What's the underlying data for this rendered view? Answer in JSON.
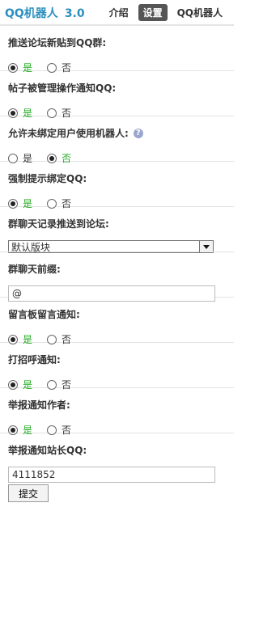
{
  "header": {
    "title": "QQ机器人",
    "version": "3.0",
    "tabs": [
      {
        "label": "介绍",
        "active": false
      },
      {
        "label": "设置",
        "active": true
      },
      {
        "label": "QQ机器人",
        "active": false
      }
    ]
  },
  "settings": {
    "push_forum_posts": {
      "label": "推送论坛新贴到QQ群:",
      "yes": "是",
      "no": "否",
      "value": "yes"
    },
    "post_admin_notify": {
      "label": "帖子被管理操作通知QQ:",
      "yes": "是",
      "no": "否",
      "value": "yes"
    },
    "allow_unbound_users": {
      "label": "允许未绑定用户使用机器人:",
      "yes": "是",
      "no": "否",
      "value": "no",
      "help_icon": "question-icon"
    },
    "force_bind_prompt": {
      "label": "强制提示绑定QQ:",
      "yes": "是",
      "no": "否",
      "value": "yes"
    },
    "group_chat_to_forum": {
      "label": "群聊天记录推送到论坛:",
      "selected": "默认版块"
    },
    "group_chat_prefix": {
      "label": "群聊天前缀:",
      "value": "@"
    },
    "guestbook_notify": {
      "label": "留言板留言通知:",
      "yes": "是",
      "no": "否",
      "value": "yes"
    },
    "greet_notify": {
      "label": "打招呼通知:",
      "yes": "是",
      "no": "否",
      "value": "yes"
    },
    "report_notify_author": {
      "label": "举报通知作者:",
      "yes": "是",
      "no": "否",
      "value": "yes"
    },
    "report_notify_admin_qq": {
      "label": "举报通知站长QQ:",
      "value": "4111852"
    }
  },
  "submit_label": "提交",
  "colors": {
    "accent": "#2b8fbf",
    "selected_green": "#22aa22",
    "tab_active_bg": "#555555"
  }
}
